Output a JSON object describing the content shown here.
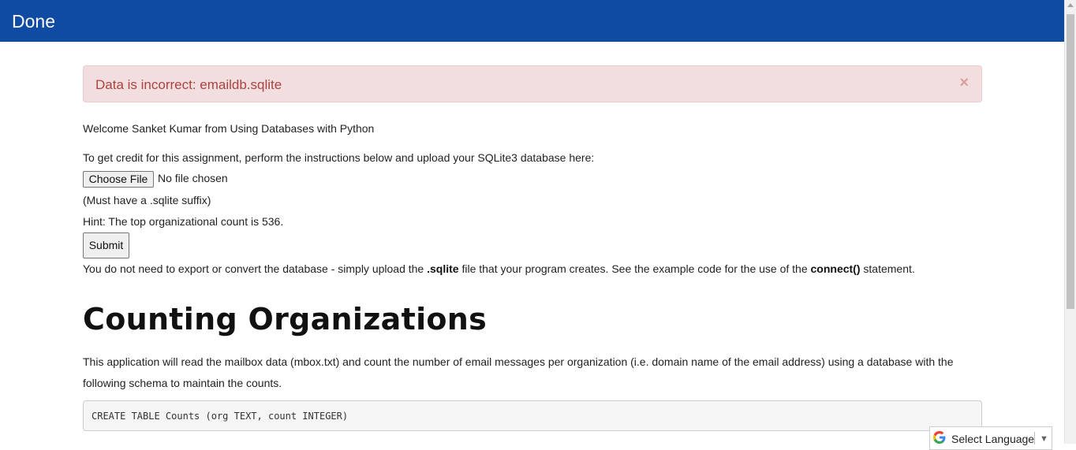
{
  "header": {
    "title": "Done"
  },
  "alert": {
    "message": "Data is incorrect: emaildb.sqlite",
    "close_label": "×"
  },
  "welcome": "Welcome Sanket Kumar from Using Databases with Python",
  "instructions": "To get credit for this assignment, perform the instructions below and upload your SQLite3 database here:",
  "file_input": {
    "button_label": "Choose File",
    "status": "No file chosen"
  },
  "suffix_note": "(Must have a .sqlite suffix)",
  "hint": "Hint: The top organizational count is 536.",
  "submit_label": "Submit",
  "export_note": {
    "part1": "You do not need to export or convert the database - simply upload the ",
    "bold1": ".sqlite",
    "part2": " file that your program creates. See the example code for the use of the ",
    "bold2": "connect()",
    "part3": " statement."
  },
  "section": {
    "title": "Counting Organizations",
    "description": "This application will read the mailbox data (mbox.txt) and count the number of email messages per organization (i.e. domain name of the email address) using a database with the following schema to maintain the counts.",
    "code": "CREATE TABLE Counts (org TEXT, count INTEGER)"
  },
  "translate": {
    "label": "Select Language",
    "arrow": "▼",
    "icon": "google-icon"
  },
  "colors": {
    "header_bg": "#0f4aa3",
    "alert_bg": "#f2dede",
    "alert_text": "#a94442"
  }
}
